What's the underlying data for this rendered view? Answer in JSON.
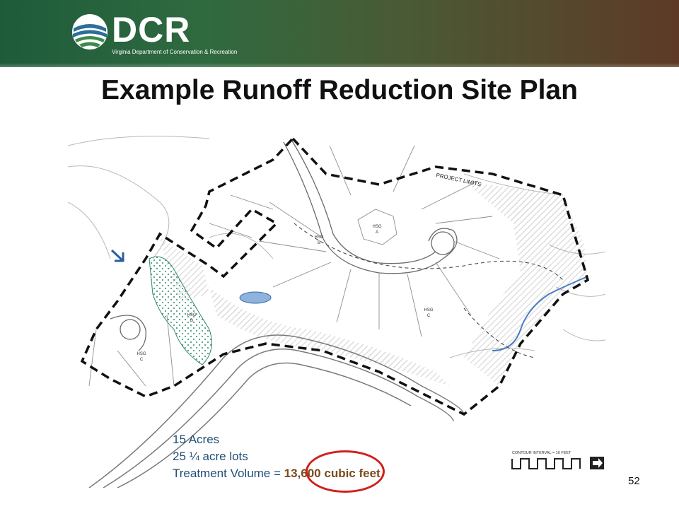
{
  "logo": {
    "text": "DCR",
    "subtitle": "Virginia Department of Conservation & Recreation"
  },
  "slide": {
    "title": "Example Runoff Reduction Site Plan",
    "page_number": "52"
  },
  "site_plan": {
    "project_limits_label": "PROJECT LIMITS",
    "hsg_labels": [
      {
        "title": "HSG",
        "group": "A"
      },
      {
        "title": "HSG",
        "group": "B"
      },
      {
        "title": "HSG",
        "group": "C"
      },
      {
        "title": "HSG",
        "group": "D"
      },
      {
        "title": "HSG",
        "group": "C"
      }
    ],
    "contour_label": "CONTOUR INTERVAL = 10 FEET"
  },
  "info": {
    "acres": "15 Acres",
    "lots": "25  ¼ acre lots",
    "treatment_prefix": "Treatment Volume = ",
    "treatment_value": "13,600 cubic feet"
  },
  "colors": {
    "accent_blue": "#1f4e79",
    "accent_brown": "#7a4a1f",
    "highlight_red": "#d0201a"
  }
}
